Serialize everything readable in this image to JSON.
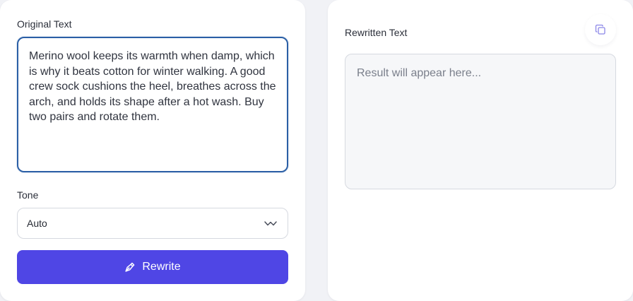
{
  "left_panel": {
    "original_label": "Original Text",
    "original_text": "Merino wool keeps its warmth when damp, which is why it beats cotton for winter walking. A good crew sock cushions the heel, breathes across the arch, and holds its shape after a hot wash. Buy two pairs and rotate them.",
    "tone_label": "Tone",
    "tone_value": "Auto",
    "rewrite_label": "Rewrite"
  },
  "right_panel": {
    "rewritten_label": "Rewritten Text",
    "result_placeholder": "Result will appear here..."
  },
  "colors": {
    "accent": "#4f46e5",
    "focus_border": "#2b5fa6",
    "copy_icon": "#8b86e8"
  },
  "icons": {
    "rewrite": "pen-tool-icon",
    "tone_select": "chevron-down-icon",
    "copy": "copy-icon"
  }
}
